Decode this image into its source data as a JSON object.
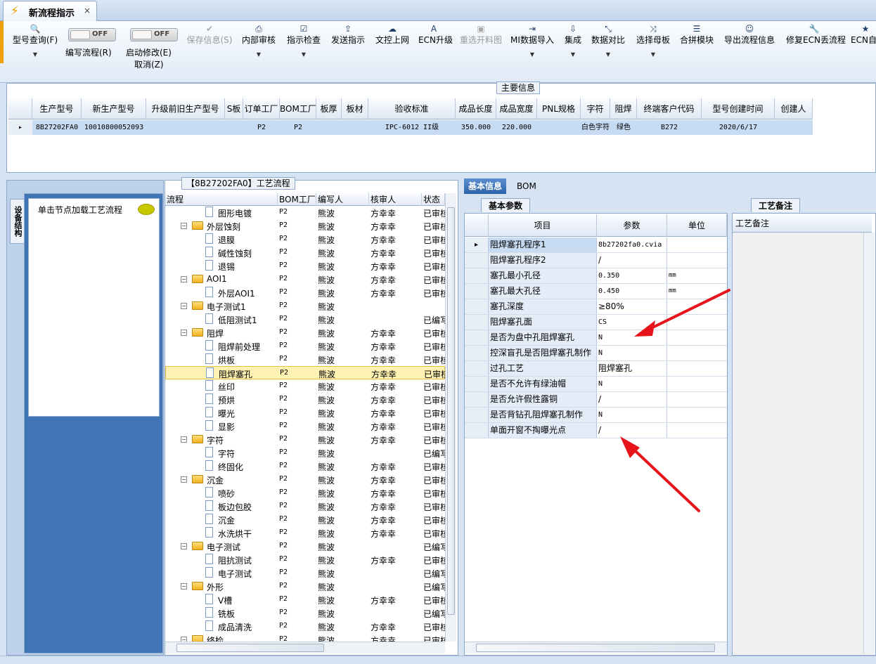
{
  "window_tab": {
    "title": "新流程指示",
    "close": "×"
  },
  "toolbar": {
    "buttons": [
      {
        "id": "model_query",
        "label": "型号查询(F)",
        "icon": "search-icon",
        "glyph": "🔍",
        "dropdown": true,
        "enabled": true
      },
      {
        "id": "save_info",
        "label": "保存信息(S)",
        "icon": "check-icon",
        "glyph": "✔",
        "dropdown": false,
        "enabled": false
      },
      {
        "id": "internal_review",
        "label": "内部审核",
        "icon": "print-icon",
        "glyph": "⎙",
        "dropdown": true,
        "enabled": true
      },
      {
        "id": "instruction_check",
        "label": "指示检查",
        "icon": "checkbox-icon",
        "glyph": "☑",
        "dropdown": true,
        "enabled": true
      },
      {
        "id": "send_instruction",
        "label": "发送指示",
        "icon": "upload-icon",
        "glyph": "⇪",
        "dropdown": false,
        "enabled": true
      },
      {
        "id": "doc_upload",
        "label": "文控上网",
        "icon": "cloud-upload-icon",
        "glyph": "☁",
        "dropdown": false,
        "enabled": true
      },
      {
        "id": "ecn_upgrade",
        "label": "ECN升级",
        "icon": "font-icon",
        "glyph": "A",
        "dropdown": false,
        "enabled": true
      },
      {
        "id": "reselect_cut",
        "label": "重选开料图",
        "icon": "image-icon",
        "glyph": "▣",
        "dropdown": false,
        "enabled": false
      },
      {
        "id": "mi_import",
        "label": "MI数据导入",
        "icon": "sign-in-icon",
        "glyph": "⇥",
        "dropdown": true,
        "enabled": true
      },
      {
        "id": "integrate",
        "label": "集成",
        "icon": "download-icon",
        "glyph": "⇩",
        "dropdown": true,
        "enabled": true
      },
      {
        "id": "data_compare",
        "label": "数据对比",
        "icon": "compress-icon",
        "glyph": "⤡",
        "dropdown": true,
        "enabled": true
      },
      {
        "id": "select_master",
        "label": "选择母板",
        "icon": "shuffle-icon",
        "glyph": "⤨",
        "dropdown": true,
        "enabled": true
      },
      {
        "id": "merge_module",
        "label": "合拼模块",
        "icon": "list-icon",
        "glyph": "☰",
        "dropdown": false,
        "enabled": true
      },
      {
        "id": "export_flow",
        "label": "导出流程信息",
        "icon": "smile-icon",
        "glyph": "☺",
        "dropdown": false,
        "enabled": true
      },
      {
        "id": "fix_ecn",
        "label": "修复ECN丢流程",
        "icon": "wrench-icon",
        "glyph": "🔧",
        "dropdown": false,
        "enabled": true
      },
      {
        "id": "ecn_auto",
        "label": "ECN自动",
        "icon": "star-icon",
        "glyph": "★",
        "dropdown": false,
        "enabled": true
      }
    ],
    "toggles": [
      {
        "id": "edit_flow",
        "state": "OFF",
        "label": "编写流程(R)"
      },
      {
        "id": "enable_modify",
        "state": "OFF",
        "label": "启动修改(E)",
        "label2": "取消(Z)"
      }
    ]
  },
  "main_info": {
    "title": "主要信息",
    "columns": [
      "生产型号",
      "新生产型号",
      "升级前旧生产型号",
      "S板",
      "订单工厂",
      "BOM工厂",
      "板厚",
      "板材",
      "验收标准",
      "成品长度",
      "成品宽度",
      "PNL规格",
      "字符",
      "阻焊",
      "终端客户代码",
      "型号创建时间",
      "创建人"
    ],
    "row": [
      "8B27202FA0",
      "10010800052093",
      "",
      "",
      "P2",
      "P2",
      "",
      "",
      "IPC-6012 II级",
      "350.000",
      "220.000",
      "",
      "白色字符",
      "绿色",
      "B272",
      "2020/6/17",
      ""
    ]
  },
  "left_panel": {
    "vertical_tab": "设备结构",
    "load_label": "单击节点加载工艺流程"
  },
  "process_panel": {
    "title": "【8B27202FA0】工艺流程",
    "columns": [
      "流程",
      "BOM工厂",
      "编写人",
      "核审人",
      "状态"
    ],
    "rows": [
      {
        "name": "图形电镀",
        "level": 1,
        "type": "doc",
        "bom": "P2",
        "writer": "熊波",
        "reviewer": "方幸幸",
        "status": "已审核"
      },
      {
        "name": "外层蚀刻",
        "level": 0,
        "type": "folder",
        "bom": "P2",
        "writer": "熊波",
        "reviewer": "方幸幸",
        "status": "已审核"
      },
      {
        "name": "退膜",
        "level": 1,
        "type": "doc",
        "bom": "P2",
        "writer": "熊波",
        "reviewer": "方幸幸",
        "status": "已审核"
      },
      {
        "name": "碱性蚀刻",
        "level": 1,
        "type": "doc",
        "bom": "P2",
        "writer": "熊波",
        "reviewer": "方幸幸",
        "status": "已审核"
      },
      {
        "name": "退锡",
        "level": 1,
        "type": "doc",
        "bom": "P2",
        "writer": "熊波",
        "reviewer": "方幸幸",
        "status": "已审核"
      },
      {
        "name": "AOI1",
        "level": 0,
        "type": "folder",
        "bom": "P2",
        "writer": "熊波",
        "reviewer": "方幸幸",
        "status": "已审核"
      },
      {
        "name": "外层AOI1",
        "level": 1,
        "type": "doc",
        "bom": "P2",
        "writer": "熊波",
        "reviewer": "方幸幸",
        "status": "已审核"
      },
      {
        "name": "电子测试1",
        "level": 0,
        "type": "folder",
        "bom": "P2",
        "writer": "熊波",
        "reviewer": "",
        "status": ""
      },
      {
        "name": "低阻测试1",
        "level": 1,
        "type": "doc",
        "bom": "P2",
        "writer": "熊波",
        "reviewer": "",
        "status": "已编写"
      },
      {
        "name": "阻焊",
        "level": 0,
        "type": "folder",
        "bom": "P2",
        "writer": "熊波",
        "reviewer": "方幸幸",
        "status": "已审核"
      },
      {
        "name": "阻焊前处理",
        "level": 1,
        "type": "doc",
        "bom": "P2",
        "writer": "熊波",
        "reviewer": "方幸幸",
        "status": "已审核"
      },
      {
        "name": "烘板",
        "level": 1,
        "type": "doc",
        "bom": "P2",
        "writer": "熊波",
        "reviewer": "方幸幸",
        "status": "已审核"
      },
      {
        "name": "阻焊塞孔",
        "level": 1,
        "type": "doc",
        "bom": "P2",
        "writer": "熊波",
        "reviewer": "方幸幸",
        "status": "已审核",
        "selected": true
      },
      {
        "name": "丝印",
        "level": 1,
        "type": "doc",
        "bom": "P2",
        "writer": "熊波",
        "reviewer": "方幸幸",
        "status": "已审核"
      },
      {
        "name": "预烘",
        "level": 1,
        "type": "doc",
        "bom": "P2",
        "writer": "熊波",
        "reviewer": "方幸幸",
        "status": "已审核"
      },
      {
        "name": "曝光",
        "level": 1,
        "type": "doc",
        "bom": "P2",
        "writer": "熊波",
        "reviewer": "方幸幸",
        "status": "已审核"
      },
      {
        "name": "显影",
        "level": 1,
        "type": "doc",
        "bom": "P2",
        "writer": "熊波",
        "reviewer": "方幸幸",
        "status": "已审核"
      },
      {
        "name": "字符",
        "level": 0,
        "type": "folder",
        "bom": "P2",
        "writer": "熊波",
        "reviewer": "方幸幸",
        "status": "已审核"
      },
      {
        "name": "字符",
        "level": 1,
        "type": "doc",
        "bom": "P2",
        "writer": "熊波",
        "reviewer": "",
        "status": "已编写"
      },
      {
        "name": "终固化",
        "level": 1,
        "type": "doc",
        "bom": "P2",
        "writer": "熊波",
        "reviewer": "方幸幸",
        "status": "已审核"
      },
      {
        "name": "沉金",
        "level": 0,
        "type": "folder",
        "bom": "P2",
        "writer": "熊波",
        "reviewer": "方幸幸",
        "status": "已审核"
      },
      {
        "name": "喷砂",
        "level": 1,
        "type": "doc",
        "bom": "P2",
        "writer": "熊波",
        "reviewer": "方幸幸",
        "status": "已审核"
      },
      {
        "name": "板边包胶",
        "level": 1,
        "type": "doc",
        "bom": "P2",
        "writer": "熊波",
        "reviewer": "方幸幸",
        "status": "已审核"
      },
      {
        "name": "沉金",
        "level": 1,
        "type": "doc",
        "bom": "P2",
        "writer": "熊波",
        "reviewer": "方幸幸",
        "status": "已审核"
      },
      {
        "name": "水洗烘干",
        "level": 1,
        "type": "doc",
        "bom": "P2",
        "writer": "熊波",
        "reviewer": "方幸幸",
        "status": "已审核"
      },
      {
        "name": "电子测试",
        "level": 0,
        "type": "folder",
        "bom": "P2",
        "writer": "熊波",
        "reviewer": "",
        "status": "已编写"
      },
      {
        "name": "阻抗测试",
        "level": 1,
        "type": "doc",
        "bom": "P2",
        "writer": "熊波",
        "reviewer": "方幸幸",
        "status": "已审核"
      },
      {
        "name": "电子测试",
        "level": 1,
        "type": "doc",
        "bom": "P2",
        "writer": "熊波",
        "reviewer": "",
        "status": "已编写"
      },
      {
        "name": "外形",
        "level": 0,
        "type": "folder",
        "bom": "P2",
        "writer": "熊波",
        "reviewer": "",
        "status": "已编写"
      },
      {
        "name": "V槽",
        "level": 1,
        "type": "doc",
        "bom": "P2",
        "writer": "熊波",
        "reviewer": "方幸幸",
        "status": "已审核"
      },
      {
        "name": "铣板",
        "level": 1,
        "type": "doc",
        "bom": "P2",
        "writer": "熊波",
        "reviewer": "",
        "status": "已编写"
      },
      {
        "name": "成品清洗",
        "level": 1,
        "type": "doc",
        "bom": "P2",
        "writer": "熊波",
        "reviewer": "方幸幸",
        "status": "已审核"
      },
      {
        "name": "终检",
        "level": 0,
        "type": "folder",
        "bom": "P2",
        "writer": "熊波",
        "reviewer": "方幸幸",
        "status": "已审核"
      }
    ]
  },
  "right_tabs": [
    "基本信息",
    "BOM"
  ],
  "basic_params": {
    "subtab": "基本参数",
    "columns": [
      "项目",
      "参数",
      "单位"
    ],
    "rows": [
      {
        "item": "阻焊塞孔程序1",
        "value": "8b27202fa0.cvia",
        "unit": "",
        "mono": true,
        "current": true
      },
      {
        "item": "阻焊塞孔程序2",
        "value": "/",
        "unit": ""
      },
      {
        "item": "塞孔最小孔径",
        "value": "0.350",
        "unit": "mm",
        "mono": true
      },
      {
        "item": "塞孔最大孔径",
        "value": "0.450",
        "unit": "mm",
        "mono": true
      },
      {
        "item": "塞孔深度",
        "value": "≥80%",
        "unit": ""
      },
      {
        "item": "阻焊塞孔面",
        "value": "CS",
        "unit": "",
        "mono": true
      },
      {
        "item": "是否为盘中孔阻焊塞孔",
        "value": "N",
        "unit": "",
        "mono": true
      },
      {
        "item": "控深盲孔是否阻焊塞孔制作",
        "value": "N",
        "unit": "",
        "mono": true
      },
      {
        "item": "过孔工艺",
        "value": "阻焊塞孔",
        "unit": ""
      },
      {
        "item": "是否不允许有绿油帽",
        "value": "N",
        "unit": "",
        "mono": true
      },
      {
        "item": "是否允许假性露铜",
        "value": "/",
        "unit": ""
      },
      {
        "item": "是否背钻孔阻焊塞孔制作",
        "value": "N",
        "unit": "",
        "mono": true
      },
      {
        "item": "单面开窗不掏曝光点",
        "value": "/",
        "unit": ""
      }
    ]
  },
  "notes": {
    "subtab": "工艺备注",
    "column": "工艺备注"
  },
  "colors": {
    "accent": "#2d62a9",
    "selection_row": "#c7dbf3",
    "tree_selected": "#fff2b3",
    "annotation_arrow": "#e8141c"
  }
}
